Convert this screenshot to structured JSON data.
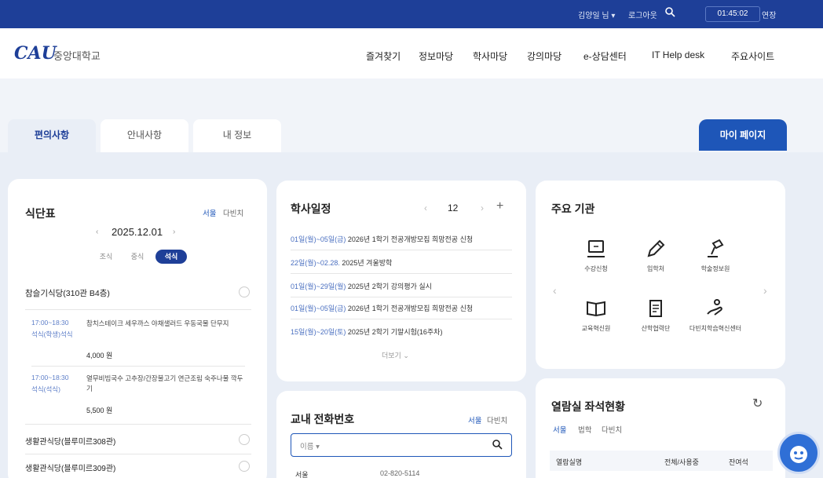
{
  "topbar": {
    "user": "김양일 님 ▾",
    "logout": "로그아웃",
    "time": "01:45:02",
    "extend": "연장"
  },
  "header": {
    "logo": "CAU",
    "school_name": "중앙대학교",
    "nav": [
      "즐겨찾기",
      "정보마당",
      "학사마당",
      "강의마당",
      "e-상담센터",
      "IT Help desk",
      "주요사이트"
    ]
  },
  "tabs": [
    "편의사항",
    "안내사항",
    "내 정보"
  ],
  "mypage_button": "마이 페이지",
  "menu": {
    "title": "식단표",
    "campus": [
      "서울",
      "다빈치"
    ],
    "date": "2025.12.01",
    "meals": [
      "조식",
      "중식",
      "석식"
    ],
    "halls": [
      {
        "name": "참슬기식당(310관 B4층)",
        "items": [
          {
            "time": "17:00~18:30",
            "type": "석식(학생)석식",
            "desc": "참치스테이크 세우까스 야채샐러드 우동국물 단무지",
            "price": "4,000 원"
          },
          {
            "time": "17:00~18:30",
            "type": "석식(석식)",
            "desc": "열무비빔국수 고추장/간장불고기 연근조림 숙주나물 깍두기",
            "price": "5,500 원"
          }
        ]
      },
      {
        "name": "생활관식당(블루미르308관)"
      },
      {
        "name": "생활관식당(블루미르309관)"
      }
    ]
  },
  "schedule": {
    "title": "학사일정",
    "month": "12",
    "rows": [
      {
        "date": "01일(월)~05일(금)",
        "text": "2026년 1학기 전공개방모집 희망전공 신청"
      },
      {
        "date": "22일(월)~02.28.",
        "text": "2025년 겨울방학"
      },
      {
        "date": "01일(월)~29일(월)",
        "text": "2025년 2학기 강의평가 실시"
      },
      {
        "date": "01일(월)~05일(금)",
        "text": "2026년 1학기 전공개방모집 희망전공 신청"
      },
      {
        "date": "15일(월)~20일(토)",
        "text": "2025년 2학기 기말시험(16주차)"
      }
    ],
    "more": "더보기 ⌄"
  },
  "institutions": {
    "title": "주요 기관",
    "items": [
      {
        "label": "수강신청",
        "icon": "monitor-icon"
      },
      {
        "label": "입학처",
        "icon": "pen-icon"
      },
      {
        "label": "학술정보원",
        "icon": "lamp-icon"
      },
      {
        "label": "교육혁신원",
        "icon": "book-icon"
      },
      {
        "label": "산학협력단",
        "icon": "document-icon"
      },
      {
        "label": "다빈치학습혁신센터",
        "icon": "hand-icon"
      }
    ]
  },
  "phone": {
    "title": "교내 전화번호",
    "campus": [
      "서울",
      "다빈치"
    ],
    "search_select": "이름 ▾",
    "first_row": {
      "name": "서울",
      "number": "02-820-5114"
    }
  },
  "reading_room": {
    "title": "열람실 좌석현황",
    "campus": [
      "서울",
      "법학",
      "다빈치"
    ],
    "headers": [
      "열람실명",
      "전체/사용중",
      "잔여석"
    ]
  },
  "colors": {
    "topbar": "#1e3f98",
    "accent": "#1e56b8",
    "page_bg": "#e9eef6"
  }
}
